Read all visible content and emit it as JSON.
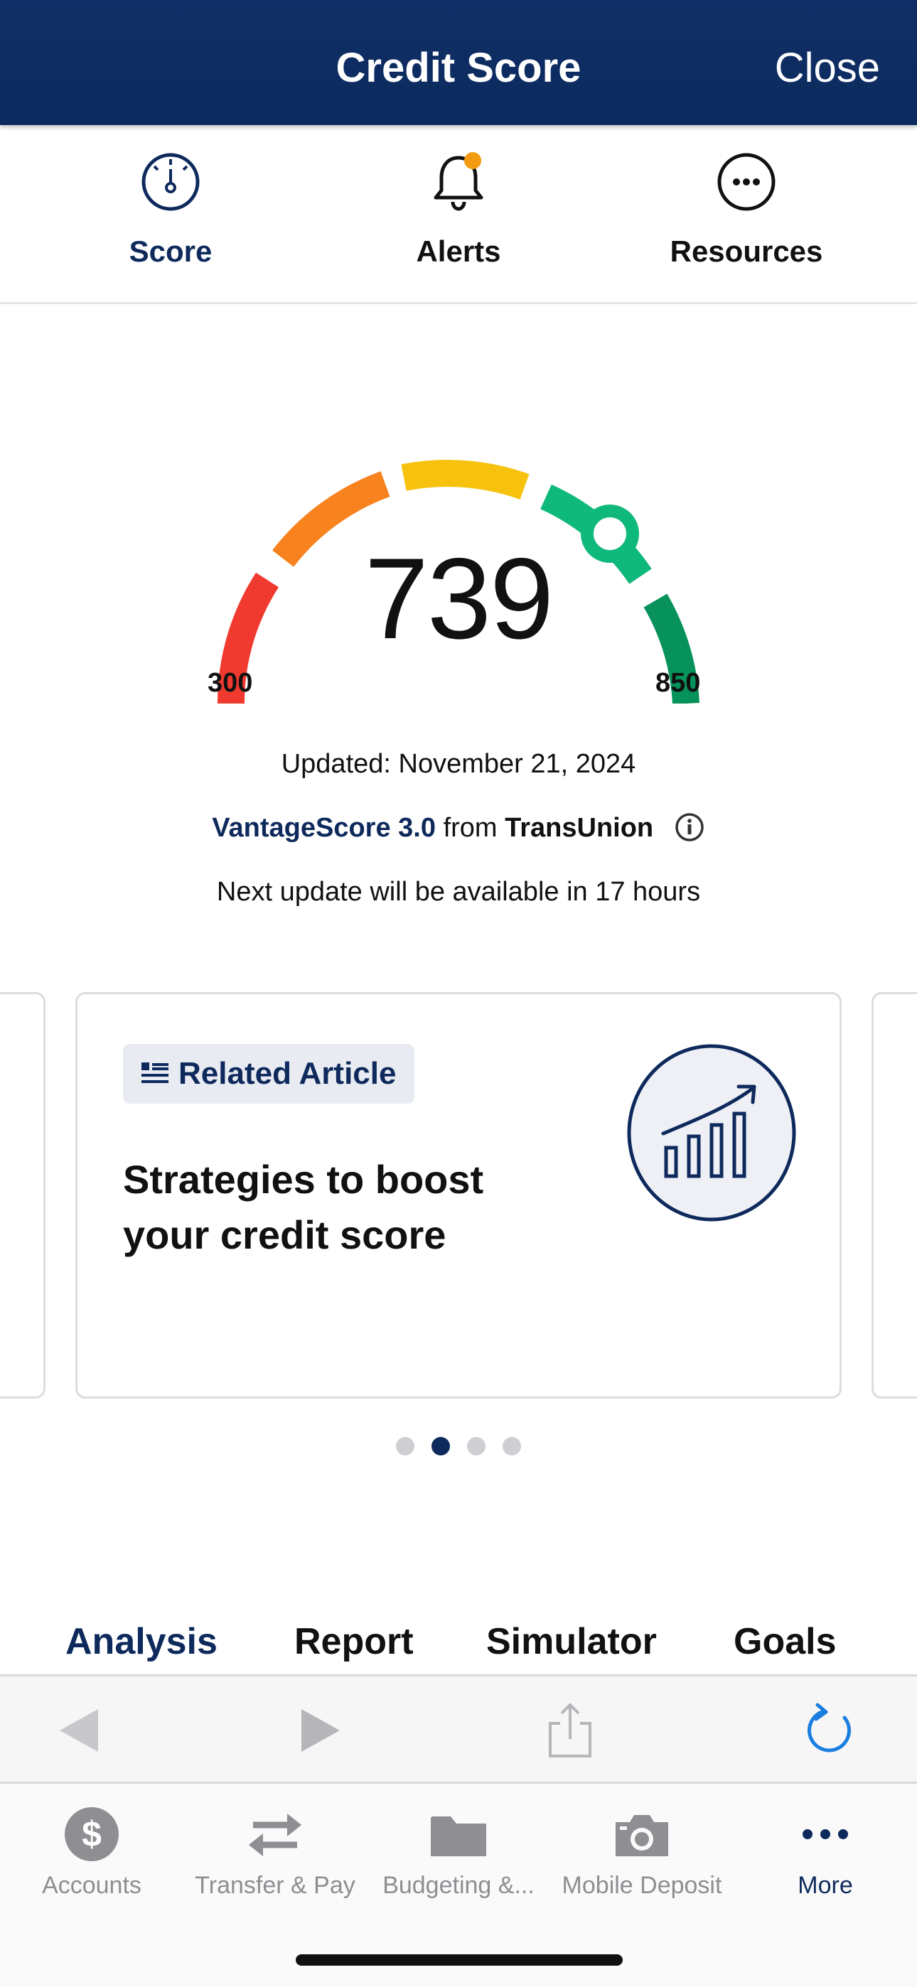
{
  "header": {
    "title": "Credit Score",
    "close_label": "Close"
  },
  "top_tabs": [
    {
      "label": "Score",
      "icon": "gauge-icon",
      "active": true
    },
    {
      "label": "Alerts",
      "icon": "bell-icon",
      "badge_color": "#f39c12"
    },
    {
      "label": "Resources",
      "icon": "more-circle-icon"
    }
  ],
  "gauge": {
    "score": "739",
    "min": "300",
    "max": "850",
    "segment_colors": [
      "#f03a30",
      "#f7821e",
      "#f6c20d",
      "#0fb87b",
      "#06925a"
    ],
    "marker_color": "#0fb87b"
  },
  "info": {
    "updated": "Updated: November 21, 2024",
    "vantage_score": "VantageScore 3.0",
    "from": "from",
    "bureau": "TransUnion",
    "next_update": "Next update will be available in 17 hours"
  },
  "card": {
    "badge_label": "Related Article",
    "title": "Strategies to boost your credit score"
  },
  "carousel": {
    "page_count": 4,
    "active_index": 1
  },
  "sub_tabs": [
    {
      "label": "Analysis",
      "active": true
    },
    {
      "label": "Report"
    },
    {
      "label": "Simulator"
    },
    {
      "label": "Goals"
    }
  ],
  "bottom_nav": [
    {
      "label": "Accounts",
      "icon": "dollar-icon"
    },
    {
      "label": "Transfer & Pay",
      "icon": "transfer-icon"
    },
    {
      "label": "Budgeting &...",
      "icon": "folder-icon"
    },
    {
      "label": "Mobile Deposit",
      "icon": "camera-icon"
    },
    {
      "label": "More",
      "icon": "more-dots-icon",
      "active": true
    }
  ],
  "colors": {
    "brand_navy": "#0e2a5c",
    "header_bg": "#0b2a5e",
    "refresh_blue": "#1a7fe0"
  }
}
